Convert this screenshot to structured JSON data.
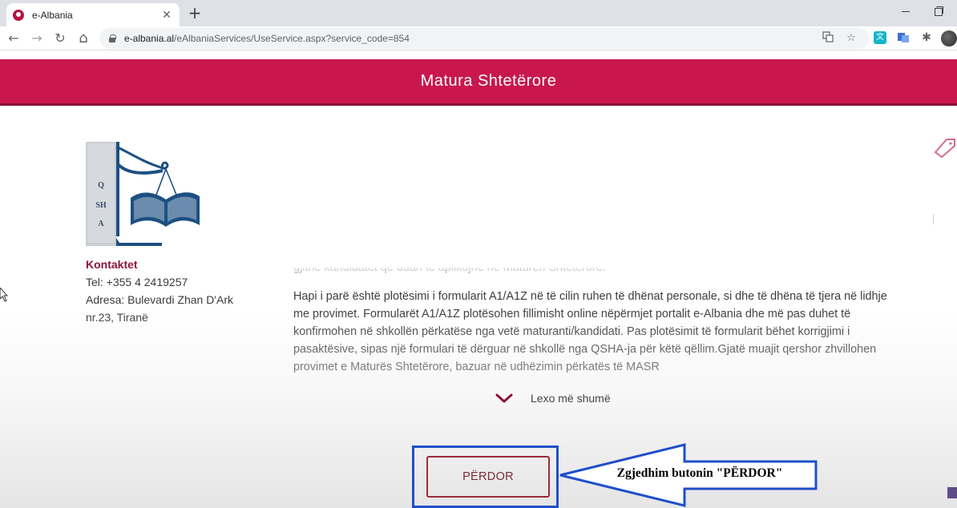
{
  "browser": {
    "tab_title": "e-Albania",
    "tab_close": "✕",
    "new_tab": "+",
    "url_domain": "e-albania.al",
    "url_path": "/eAlbaniaServices/UseService.aspx?service_code=854",
    "nav_back": "←",
    "nav_forward": "→",
    "nav_reload": "↻",
    "nav_home": "⌂"
  },
  "header": {
    "title": "Matura Shtetërore"
  },
  "logo": {
    "letters": [
      "Q",
      "SH",
      "A"
    ]
  },
  "contacts": {
    "title": "Kontaktet",
    "phone": "Tel:  +355 4 2419257",
    "address_line1": "Adresa:  Bulevardi Zhan D'Ark",
    "address_line2": "nr.23, Tiranë"
  },
  "content": {
    "paragraph_clipped": "gjithë kandidatët që duan të aplikojnë në Maturën Shtetërore.",
    "paragraph_main": "Hapi i parë është plotësimi i formularit A1/A1Z në të cilin ruhen të dhënat personale, si dhe të dhëna të tjera në lidhje me provimet. Formularët A1/A1Z plotësohen fillimisht online nëpërmjet portalit e-Albania dhe më pas duhet të konfirmohen në shkollën përkatëse nga vetë maturanti/kandidati. Pas plotësimit të formularit bëhet korrigjimi i pasaktësive, sipas një formulari të dërguar në shkollë nga QSHA-ja për këtë qëllim.Gjatë muajit qershor zhvillohen provimet e Maturës Shtetërore, bazuar në udhëzimin përkatës të MASR",
    "read_more": "Lexo më shumë"
  },
  "actions": {
    "use_button": "PËRDOR"
  },
  "annotation": {
    "text": "Zgjedhim butonin \"PËRDOR\""
  },
  "colors": {
    "brand": "#c8174d",
    "brand_dark": "#8c1538",
    "annotation_blue": "#1f4fc9"
  }
}
